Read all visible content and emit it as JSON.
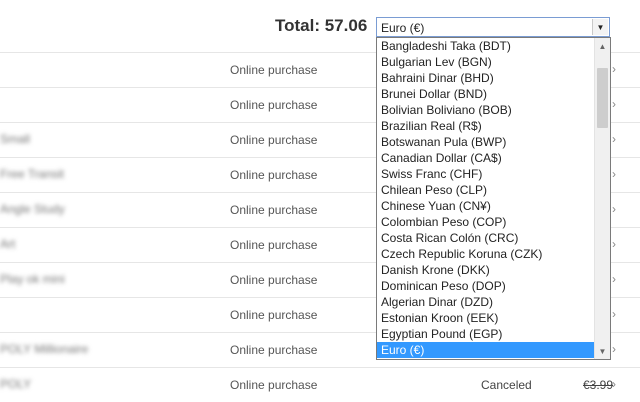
{
  "header": {
    "total_label": "Total: 57.06"
  },
  "currency_select": {
    "value": "Euro (€)"
  },
  "rows": [
    {
      "item": "",
      "type": "Online purchase",
      "status": "",
      "price": ""
    },
    {
      "item": "",
      "type": "Online purchase",
      "status": "",
      "price": ""
    },
    {
      "item": "Small",
      "type": "Online purchase",
      "status": "",
      "price": ""
    },
    {
      "item": "Free Transit",
      "type": "Online purchase",
      "status": "",
      "price": ""
    },
    {
      "item": "Angle Study",
      "type": "Online purchase",
      "status": "",
      "price": ""
    },
    {
      "item": "Art",
      "type": "Online purchase",
      "status": "",
      "price": ""
    },
    {
      "item": "Play ok mini",
      "type": "Online purchase",
      "status": "",
      "price": ""
    },
    {
      "item": "",
      "type": "Online purchase",
      "status": "",
      "price": ""
    },
    {
      "item": "POLY Millionaire",
      "type": "Online purchase",
      "status": "",
      "price": ""
    },
    {
      "item": "POLY",
      "type": "Online purchase",
      "status": "Canceled",
      "price": "€3.99"
    }
  ],
  "dropdown": {
    "options": [
      "Bangladeshi Taka (BDT)",
      "Bulgarian Lev (BGN)",
      "Bahraini Dinar (BHD)",
      "Brunei Dollar (BND)",
      "Bolivian Boliviano (BOB)",
      "Brazilian Real (R$)",
      "Botswanan Pula (BWP)",
      "Canadian Dollar (CA$)",
      "Swiss Franc (CHF)",
      "Chilean Peso (CLP)",
      "Chinese Yuan (CN¥)",
      "Colombian Peso (COP)",
      "Costa Rican Colón (CRC)",
      "Czech Republic Koruna (CZK)",
      "Danish Krone (DKK)",
      "Dominican Peso (DOP)",
      "Algerian Dinar (DZD)",
      "Estonian Kroon (EEK)",
      "Egyptian Pound (EGP)",
      "Euro (€)"
    ],
    "selected_index": 19
  }
}
